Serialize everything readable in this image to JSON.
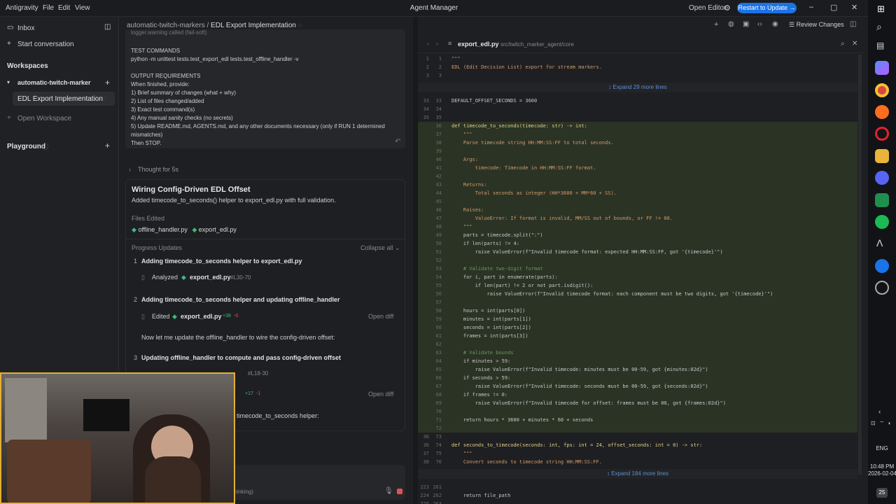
{
  "app": {
    "name": "Antigravity",
    "menu": [
      "File",
      "Edit",
      "View"
    ],
    "window_title": "Agent Manager",
    "open_editor": "Open Editor",
    "restart_button": "Restart to Update →"
  },
  "sidebar": {
    "inbox": "Inbox",
    "start_conversation": "Start conversation",
    "workspaces_heading": "Workspaces",
    "workspace_name": "automatic-twitch-marker",
    "active_item": "EDL Export Implementation",
    "open_workspace": "Open Workspace",
    "playground": "Playground"
  },
  "chat": {
    "breadcrumb_workspace": "automatic-twitch-markers",
    "breadcrumb_sep": "/",
    "breadcrumb_item": "EDL Export Implementation",
    "prompt_lines": [
      "logger.warning called (fail-soft)",
      "",
      "TEST COMMANDS",
      "python -m unittest tests.test_export_edl tests.test_offline_handler -v",
      "",
      "OUTPUT REQUIREMENTS",
      "When finished, provide:",
      "1) Brief summary of changes (what + why)",
      "2) List of files changed/added",
      "3) Exact test command(s)",
      "4) Any manual sanity checks (no secrets)",
      "5) Update README.md, AGENTS.md, and any other documents necessary (only if RUN 1 determined",
      "mismatches)",
      "Then STOP."
    ],
    "thought": "Thought for 5s",
    "task_title": "Wiring Config-Driven EDL Offset",
    "task_summary": "Added timecode_to_seconds() helper to export_edl.py with full validation.",
    "files_edited_label": "Files Edited",
    "files_edited": [
      "offline_handler.py",
      "export_edl.py"
    ],
    "progress_label": "Progress Updates",
    "collapse_all": "Collapse all",
    "steps": [
      {
        "num": "1",
        "title": "Adding timecode_to_seconds helper to export_edl.py",
        "action": "Analyzed",
        "file": "export_edl.py",
        "extra": "#L30-70"
      },
      {
        "num": "2",
        "title": "Adding timecode_to_seconds helper and updating offline_handler",
        "action": "Edited",
        "file": "export_edl.py",
        "added": "+38",
        "removed": "-0",
        "open_diff": "Open diff"
      },
      {
        "num": "3",
        "title": "Updating offline_handler to compute and pass config-driven offset",
        "extra": "#L18-30",
        "added": "+17",
        "removed": "-1",
        "open_diff": "Open diff"
      }
    ],
    "note": "Now let me update the offline_handler to wire the config-driven offset:",
    "tail_text": "timecode_to_seconds helper:",
    "input_status": "hinking)"
  },
  "editor": {
    "file_name": "export_edl.py",
    "file_path": "src/twitch_marker_agent/core",
    "review_changes": "Review Changes",
    "expand_top": "Expand 29 more lines",
    "expand_bottom": "Expand 184 more lines",
    "lines": [
      {
        "a": "1",
        "b": "1",
        "t": "\"\"\"",
        "c": "#d39b6a",
        "hl": false
      },
      {
        "a": "2",
        "b": "2",
        "t": "EDL (Edit Decision List) export for stream markers.",
        "c": "#d39b6a",
        "hl": false
      },
      {
        "a": "3",
        "b": "3",
        "t": "",
        "c": "#c8c8c8",
        "hl": false
      },
      {
        "sep": "top"
      },
      {
        "a": "33",
        "b": "33",
        "t": "DEFAULT_OFFSET_SECONDS = 3600",
        "c": "#c8c8c8",
        "hl": false
      },
      {
        "a": "34",
        "b": "34",
        "t": "",
        "c": "#c8c8c8",
        "hl": false
      },
      {
        "a": "35",
        "b": "35",
        "t": "",
        "c": "#c8c8c8",
        "hl": false
      },
      {
        "a": "",
        "b": "36",
        "t": "def timecode_to_seconds(timecode: str) -> int:",
        "c": "#e0d08a",
        "hl": true
      },
      {
        "a": "",
        "b": "37",
        "t": "    \"\"\"",
        "c": "#d39b6a",
        "hl": true
      },
      {
        "a": "",
        "b": "38",
        "t": "    Parse timecode string HH:MM:SS:FF to total seconds.",
        "c": "#d39b6a",
        "hl": true
      },
      {
        "a": "",
        "b": "39",
        "t": "",
        "c": "#c8c8c8",
        "hl": true
      },
      {
        "a": "",
        "b": "40",
        "t": "    Args:",
        "c": "#d39b6a",
        "hl": true
      },
      {
        "a": "",
        "b": "41",
        "t": "        timecode: Timecode in HH:MM:SS:FF format.",
        "c": "#d39b6a",
        "hl": true
      },
      {
        "a": "",
        "b": "42",
        "t": "",
        "c": "#c8c8c8",
        "hl": true
      },
      {
        "a": "",
        "b": "43",
        "t": "    Returns:",
        "c": "#d39b6a",
        "hl": true
      },
      {
        "a": "",
        "b": "44",
        "t": "        Total seconds as integer (HH*3600 + MM*60 + SS).",
        "c": "#d39b6a",
        "hl": true
      },
      {
        "a": "",
        "b": "45",
        "t": "",
        "c": "#c8c8c8",
        "hl": true
      },
      {
        "a": "",
        "b": "46",
        "t": "    Raises:",
        "c": "#d39b6a",
        "hl": true
      },
      {
        "a": "",
        "b": "47",
        "t": "        ValueError: If format is invalid, MM/SS out of bounds, or FF != 00.",
        "c": "#d39b6a",
        "hl": true
      },
      {
        "a": "",
        "b": "48",
        "t": "    \"\"\"",
        "c": "#d39b6a",
        "hl": true
      },
      {
        "a": "",
        "b": "49",
        "t": "    parts = timecode.split(\":\")",
        "c": "#c8c8c8",
        "hl": true
      },
      {
        "a": "",
        "b": "50",
        "t": "    if len(parts) != 4:",
        "c": "#c8c8c8",
        "hl": true
      },
      {
        "a": "",
        "b": "51",
        "t": "        raise ValueError(f\"Invalid timecode format: expected HH:MM:SS:FF, got '{timecode}'\")",
        "c": "#c8c8c8",
        "hl": true
      },
      {
        "a": "",
        "b": "52",
        "t": "",
        "c": "#c8c8c8",
        "hl": true
      },
      {
        "a": "",
        "b": "53",
        "t": "    # Validate two-digit format",
        "c": "#6a9955",
        "hl": true
      },
      {
        "a": "",
        "b": "54",
        "t": "    for i, part in enumerate(parts):",
        "c": "#c8c8c8",
        "hl": true
      },
      {
        "a": "",
        "b": "55",
        "t": "        if len(part) != 2 or not part.isdigit():",
        "c": "#c8c8c8",
        "hl": true
      },
      {
        "a": "",
        "b": "56",
        "t": "            raise ValueError(f\"Invalid timecode format: each component must be two digits, got '{timecode}'\")",
        "c": "#c8c8c8",
        "hl": true
      },
      {
        "a": "",
        "b": "57",
        "t": "",
        "c": "#c8c8c8",
        "hl": true
      },
      {
        "a": "",
        "b": "58",
        "t": "    hours = int(parts[0])",
        "c": "#c8c8c8",
        "hl": true
      },
      {
        "a": "",
        "b": "59",
        "t": "    minutes = int(parts[1])",
        "c": "#c8c8c8",
        "hl": true
      },
      {
        "a": "",
        "b": "60",
        "t": "    seconds = int(parts[2])",
        "c": "#c8c8c8",
        "hl": true
      },
      {
        "a": "",
        "b": "61",
        "t": "    frames = int(parts[3])",
        "c": "#c8c8c8",
        "hl": true
      },
      {
        "a": "",
        "b": "62",
        "t": "",
        "c": "#c8c8c8",
        "hl": true
      },
      {
        "a": "",
        "b": "63",
        "t": "    # Validate bounds",
        "c": "#6a9955",
        "hl": true
      },
      {
        "a": "",
        "b": "64",
        "t": "    if minutes > 59:",
        "c": "#c8c8c8",
        "hl": true
      },
      {
        "a": "",
        "b": "65",
        "t": "        raise ValueError(f\"Invalid timecode: minutes must be 00-59, got {minutes:02d}\")",
        "c": "#c8c8c8",
        "hl": true
      },
      {
        "a": "",
        "b": "66",
        "t": "    if seconds > 59:",
        "c": "#c8c8c8",
        "hl": true
      },
      {
        "a": "",
        "b": "67",
        "t": "        raise ValueError(f\"Invalid timecode: seconds must be 00-59, got {seconds:02d}\")",
        "c": "#c8c8c8",
        "hl": true
      },
      {
        "a": "",
        "b": "68",
        "t": "    if frames != 0:",
        "c": "#c8c8c8",
        "hl": true
      },
      {
        "a": "",
        "b": "69",
        "t": "        raise ValueError(f\"Invalid timecode for offset: frames must be 00, got {frames:02d}\")",
        "c": "#c8c8c8",
        "hl": true
      },
      {
        "a": "",
        "b": "70",
        "t": "",
        "c": "#c8c8c8",
        "hl": true
      },
      {
        "a": "",
        "b": "71",
        "t": "    return hours * 3600 + minutes * 60 + seconds",
        "c": "#c8c8c8",
        "hl": true
      },
      {
        "a": "",
        "b": "72",
        "t": "",
        "c": "#c8c8c8",
        "hl": true
      },
      {
        "a": "36",
        "b": "73",
        "t": "",
        "c": "#c8c8c8",
        "hl": false
      },
      {
        "a": "36",
        "b": "74",
        "t": "def seconds_to_timecode(seconds: int, fps: int = 24, offset_seconds: int = 0) -> str:",
        "c": "#e0d08a",
        "hl": false
      },
      {
        "a": "37",
        "b": "75",
        "t": "    \"\"\"",
        "c": "#d39b6a",
        "hl": false
      },
      {
        "a": "38",
        "b": "76",
        "t": "    Convert seconds to timecode string HH:MM:SS:FF.",
        "c": "#d39b6a",
        "hl": false
      },
      {
        "sep": "bottom"
      },
      {
        "a": "223",
        "b": "261",
        "t": "",
        "c": "#c8c8c8",
        "hl": false
      },
      {
        "a": "224",
        "b": "262",
        "t": "    return file_path",
        "c": "#c8c8c8",
        "hl": false
      },
      {
        "a": "225",
        "b": "263",
        "t": "",
        "c": "#c8c8c8",
        "hl": false
      }
    ]
  },
  "taskbar": {
    "lang": "ENG",
    "time": "10:48 PM",
    "date": "2026-02-04",
    "notif_count": "25"
  },
  "colors": {
    "accent": "#1a73e8",
    "file_icon": "#3fb87c",
    "added": "#3fb87c",
    "removed": "#e05252",
    "highlight": "#2b3325"
  }
}
